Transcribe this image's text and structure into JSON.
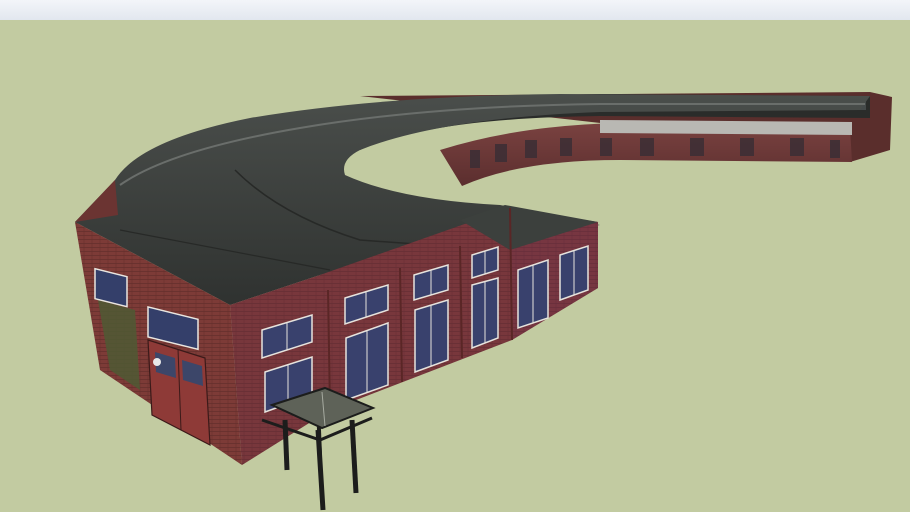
{
  "scene": {
    "subject": "roundhouse-3d-model",
    "colors": {
      "sky": "#eef1f6",
      "ground": "#c2cba1",
      "roof": "#3a3d3b",
      "roof_highlight": "#5b5f5c",
      "brick": "#7a3a36",
      "brick_dark": "#5a2a2c",
      "window": "#3a4670",
      "door": "#8c3a38",
      "table_top": "#5e6258",
      "table_legs": "#1c1d1c"
    }
  }
}
